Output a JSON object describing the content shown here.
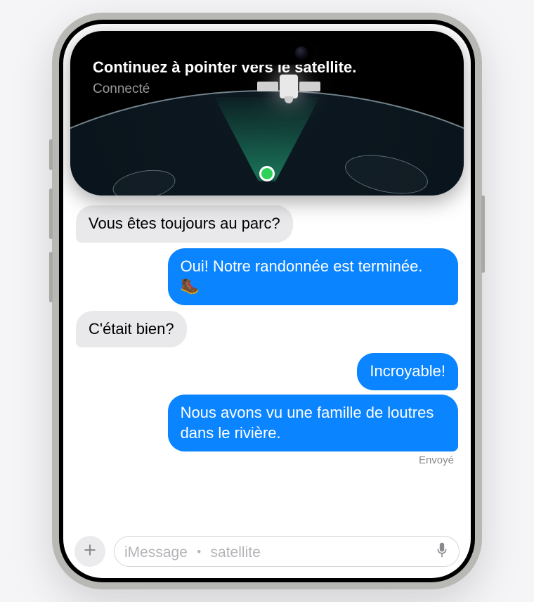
{
  "satellite_overlay": {
    "instruction": "Continuez à pointer vers le satellite.",
    "status": "Connecté"
  },
  "conversation": {
    "messages": [
      {
        "direction": "received",
        "text": "Vous êtes toujours au parc?"
      },
      {
        "direction": "sent",
        "text": "Oui! Notre randonnée est terminée. 🥾"
      },
      {
        "direction": "received",
        "text": "C'était bien?"
      },
      {
        "direction": "sent",
        "text": "Incroyable!"
      },
      {
        "direction": "sent",
        "text": "Nous avons vu une famille de loutres dans le rivière."
      }
    ],
    "last_status": "Envoyé"
  },
  "composer": {
    "placeholder": "iMessage ・ satellite"
  },
  "colors": {
    "sent_bubble": "#0a84ff",
    "received_bubble": "#e9e9eb",
    "connected_dot": "#30d158"
  }
}
